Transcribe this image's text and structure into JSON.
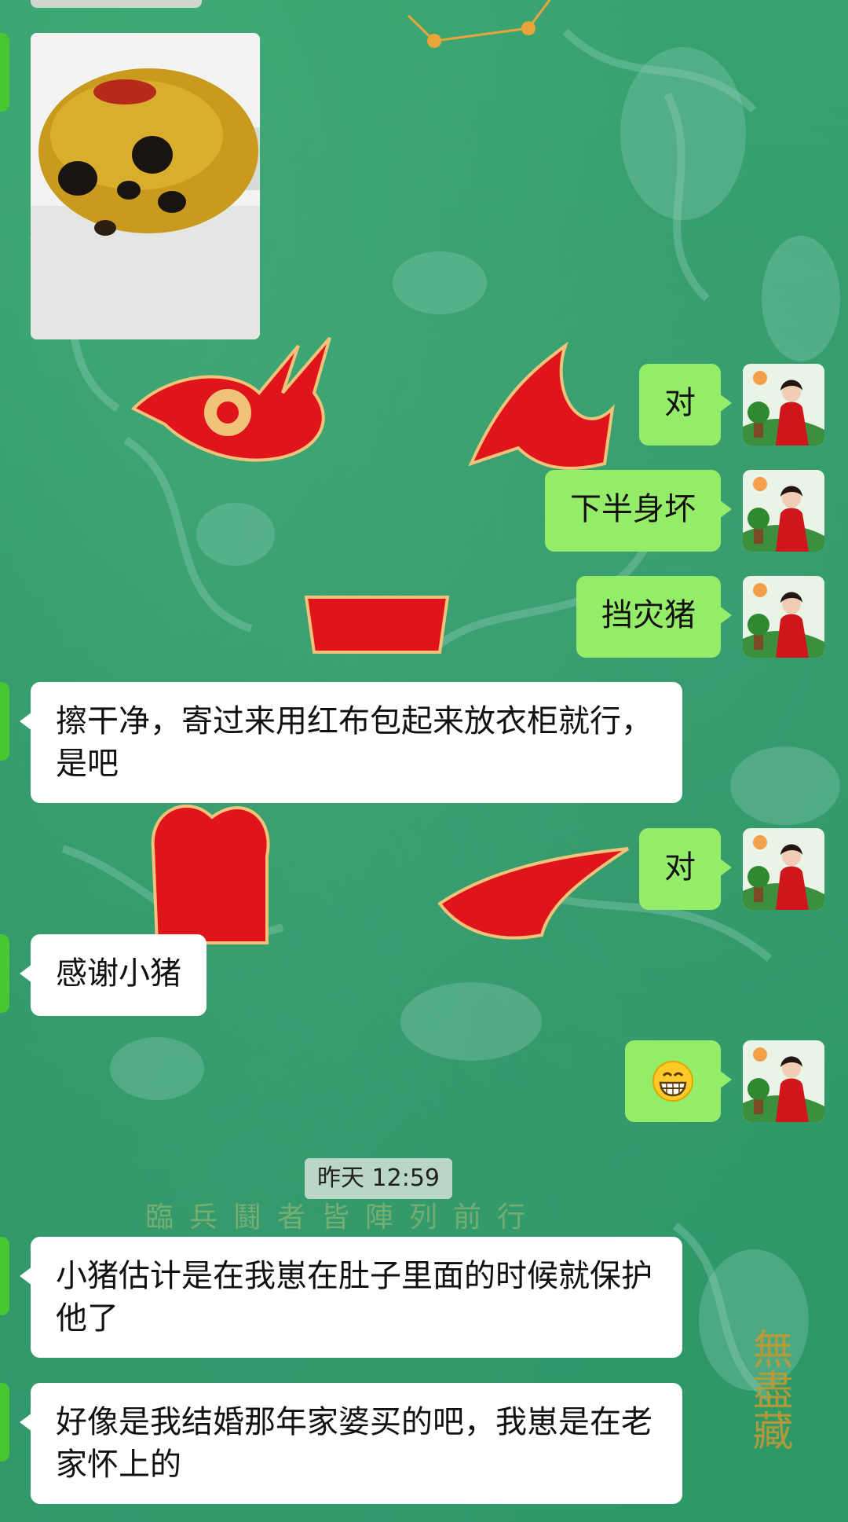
{
  "timestamp": "昨天 12:59",
  "background": {
    "caption": "臨兵鬪者皆陣列前行",
    "seal": "無盡藏"
  },
  "messages": [
    {
      "id": "m1",
      "side": "them",
      "type": "image",
      "description": "golden pig piggy bank photo"
    },
    {
      "id": "m2",
      "side": "me",
      "text": "对"
    },
    {
      "id": "m3",
      "side": "me",
      "text": "下半身坏"
    },
    {
      "id": "m4",
      "side": "me",
      "text": "挡灾猪"
    },
    {
      "id": "m5",
      "side": "them",
      "text": "擦干净，寄过来用红布包起来放衣柜就行，是吧"
    },
    {
      "id": "m6",
      "side": "me",
      "text": "对"
    },
    {
      "id": "m7",
      "side": "them",
      "text": "感谢小猪"
    },
    {
      "id": "m8",
      "side": "me",
      "type": "emoji",
      "emoji": "grin-icon"
    },
    {
      "id": "m9",
      "side": "them",
      "text": "小猪估计是在我崽在肚子里面的时候就保护他了"
    },
    {
      "id": "m10",
      "side": "them",
      "text": "好像是我结婚那年家婆买的吧，我崽是在老家怀上的"
    }
  ],
  "colors": {
    "me_bubble": "#95ec69",
    "them_bubble": "#ffffff",
    "background": "#2f9a6a",
    "red_glyph": "#e0141b"
  }
}
